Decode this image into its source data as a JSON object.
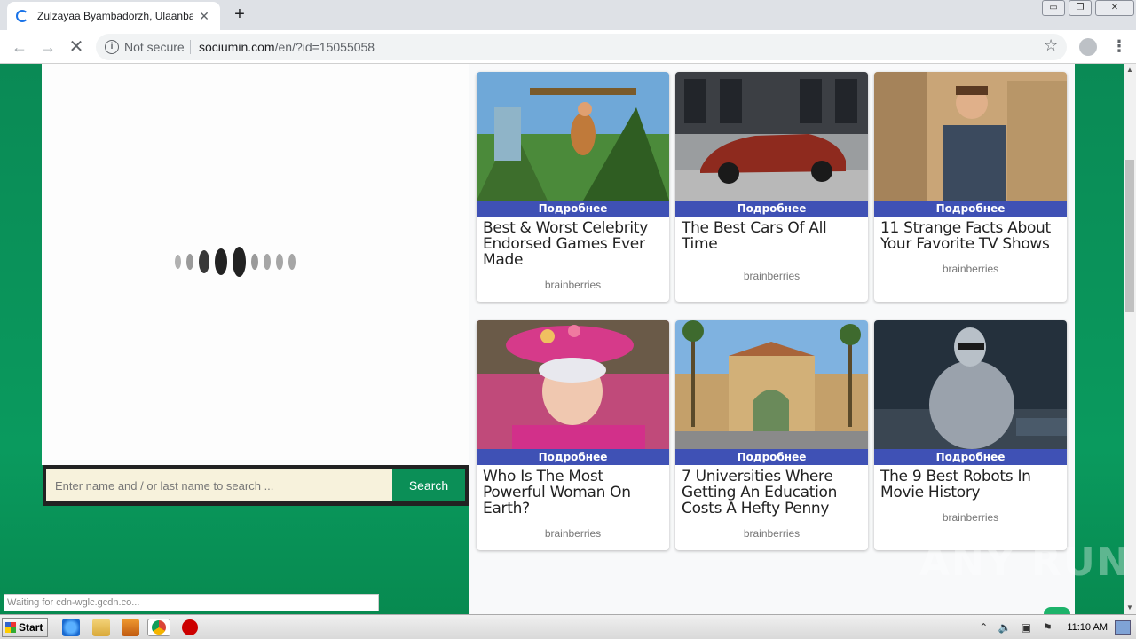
{
  "browser": {
    "tab_title": "Zulzayaa Byambadorzh, Ulaanbaatar",
    "tab_close": "✕",
    "new_tab": "+",
    "security_label": "Not secure",
    "url_host": "sociumin.com",
    "url_path": "/en/?id=15055058",
    "window_controls": [
      "▭",
      "❐",
      "✕"
    ]
  },
  "search": {
    "placeholder": "Enter name and / or last name to search ...",
    "button_label": "Search"
  },
  "cards": [
    {
      "badge": "Подробнее",
      "title": "Best & Worst Celebrity Endorsed Games Ever Made",
      "source": "brainberries",
      "image": "jungle-game-character"
    },
    {
      "badge": "Подробнее",
      "title": "The Best Cars Of All Time",
      "source": "brainberries",
      "image": "red-car"
    },
    {
      "badge": "Подробнее",
      "title": "11 Strange Facts About Your Favorite TV Shows",
      "source": "brainberries",
      "image": "tv-show-actor"
    },
    {
      "badge": "Подробнее",
      "title": "Who Is The Most Powerful Woman On Earth?",
      "source": "brainberries",
      "image": "queen-pink-hat"
    },
    {
      "badge": "Подробнее",
      "title": "7 Universities Where Getting An Education Costs A Hefty Penny",
      "source": "brainberries",
      "image": "university-arch"
    },
    {
      "badge": "Подробнее",
      "title": "The 9 Best Robots In Movie History",
      "source": "brainberries",
      "image": "robocop"
    }
  ],
  "status_bar": "Waiting for cdn-wglc.gcdn.co...",
  "watermark": "ANY RUN",
  "taskbar": {
    "start_label": "Start",
    "time": "11:10 AM"
  },
  "colors": {
    "page_green": "#0a8a55",
    "badge_blue": "#3f51b5",
    "search_button": "#0b8f57"
  }
}
